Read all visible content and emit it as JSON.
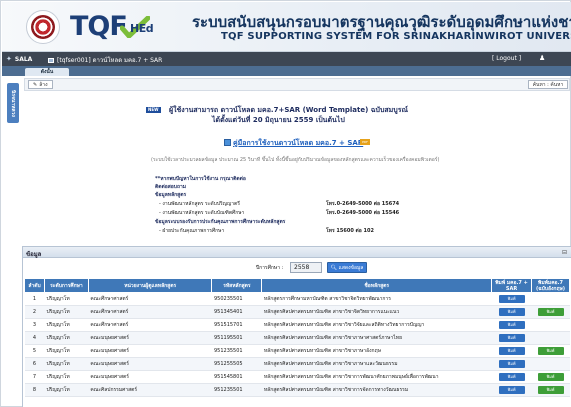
{
  "header": {
    "logo_text": "TQF",
    "logo_sub": "HEd",
    "title_th": "ระบบสนับสนุนกรอบมาตรฐานคุณวุฒิระดับอุดมศึกษาแห่งชาติ",
    "title_en": "TQF SUPPORTING SYSTEM FOR SRINAKHARINWIROT UNIVERSITY"
  },
  "topbar": {
    "app": "SALA",
    "user": "[tqfser001] ดาวน์โหลด มคอ.7 + SAR",
    "logout": "[ Logout ]"
  },
  "tabs": {
    "active": "ดังนั้น"
  },
  "sidetab": {
    "label": "นิรจนาหลวง"
  },
  "toolbar": {
    "back_label": "ล้าง",
    "search_label": "ค้นหา : ค้นหา"
  },
  "announcement": {
    "new_badge": "NEW",
    "line1": "ผู้ใช้งานสามารถ ดาวน์โหลด มคอ.7+SAR (Word Template) ฉบับสมบูรณ์",
    "line2": "ได้ตั้งแต่วันที่ 20 มิถุนายน 2559 เป็นต้นไป",
    "manual_link": "คู่มือการใช้งานดาวน์โหลด มคอ.7 + SAR",
    "manual_badge": "PDF",
    "note": "(ระบบใช้เวลาประมวลผลข้อมูล ประมาณ 25 วินาที ขึ้นไป ทั้งนี้ขึ้นอยู่กับปริมาณข้อมูลของหลักสูตรและความเร็วของเครื่องคอมพิวเตอร์)",
    "star": "**หากพบปัญหาในการใช้งาน กรุณาติดต่อ",
    "contact_heading": "ติดต่อสอบถาม",
    "c1_heading": "ข้อมูลหลักสูตร",
    "rows1": [
      {
        "label": "- งานพัฒนาหลักสูตร ระดับปริญญาตรี",
        "tel": "โทร.0-2649-5000 ต่อ 15674"
      },
      {
        "label": "- งานพัฒนาหลักสูตร ระดับบัณฑิตศึกษา",
        "tel": "โทร.0-2649-5000 ต่อ 15546"
      }
    ],
    "c2_heading": "ข้อมูลระบบรองรับการประกันคุณภาพการศึกษาระดับหลักสูตร",
    "rows2": [
      {
        "label": "- ฝ่ายประกันคุณภาพการศึกษา",
        "tel": "โทร 15600 ต่อ 102"
      }
    ]
  },
  "panel": {
    "title": "ข้อมูล",
    "filter_label": "ปีการศึกษา :",
    "filter_year": "2558",
    "filter_button": "แสดงข้อมูล"
  },
  "table": {
    "headers": [
      "ลำดับ",
      "ระดับการศึกษา",
      "หน่วยงานผู้ดูแลหลักสูตร",
      "รหัสหลักสูตร",
      "ชื่อหลักสูตร",
      "พิมพ์ มคอ.7 + SAR",
      "พิมพ์มคอ.7 (ฉบับอังกฤษ)"
    ],
    "rows": [
      {
        "no": "1",
        "level": "ปริญญาโท",
        "faculty": "คณะศึกษาศาสตร์",
        "code": "950235501",
        "name": "หลักสูตรการศึกษามหาบัณฑิต สาขาวิชาจิตวิทยาพัฒนาการ",
        "a": "พิมพ์",
        "b": ""
      },
      {
        "no": "2",
        "level": "ปริญญาโท",
        "faculty": "คณะศึกษาศาสตร์",
        "code": "951345401",
        "name": "หลักสูตรศิลปศาสตรมหาบัณฑิต สาขาวิชาจิตวิทยาการแนะแนว",
        "a": "พิมพ์",
        "b": "พิมพ์"
      },
      {
        "no": "3",
        "level": "ปริญญาโท",
        "faculty": "คณะศึกษาศาสตร์",
        "code": "951515701",
        "name": "หลักสูตรศิลปศาสตรมหาบัณฑิต สาขาวิชาวิจัยและสถิติทางวิทยาการปัญญา",
        "a": "พิมพ์",
        "b": ""
      },
      {
        "no": "4",
        "level": "ปริญญาโท",
        "faculty": "คณะมนุษยศาสตร์",
        "code": "951195501",
        "name": "หลักสูตรศิลปศาสตรมหาบัณฑิต สาขาวิชาภาษาศาสตร์ภาษาไทย",
        "a": "พิมพ์",
        "b": ""
      },
      {
        "no": "5",
        "level": "ปริญญาโท",
        "faculty": "คณะมนุษยศาสตร์",
        "code": "951235501",
        "name": "หลักสูตรศิลปศาสตรมหาบัณฑิต สาขาวิชาภาษาอังกฤษ",
        "a": "พิมพ์",
        "b": "พิมพ์"
      },
      {
        "no": "6",
        "level": "ปริญญาโท",
        "faculty": "คณะมนุษยศาสตร์",
        "code": "951255505",
        "name": "หลักสูตรศิลปศาสตรมหาบัณฑิต สาขาวิชาภาษาและวัฒนธรรม",
        "a": "พิมพ์",
        "b": ""
      },
      {
        "no": "7",
        "level": "ปริญญาโท",
        "faculty": "คณะมนุษยศาสตร์",
        "code": "951545801",
        "name": "หลักสูตรศิลปศาสตรมหาบัณฑิต สาขาวิชาการพัฒนาศักยภาพมนุษย์เพื่อการพัฒนา",
        "a": "พิมพ์",
        "b": "พิมพ์"
      },
      {
        "no": "8",
        "level": "ปริญญาโท",
        "faculty": "คณะศิลปกรรมศาสตร์",
        "code": "951235501",
        "name": "หลักสูตรศิลปศาสตรมหาบัณฑิต สาขาวิชาการจัดการทางวัฒนธรรม",
        "a": "พิมพ์",
        "b": "พิมพ์"
      }
    ]
  },
  "colors": {
    "header_blue": "#15355f",
    "table_header": "#3f78b8",
    "print_button": "#2f6fbf",
    "print_en_button": "#3e9e38",
    "topbar": "#3d4653"
  }
}
